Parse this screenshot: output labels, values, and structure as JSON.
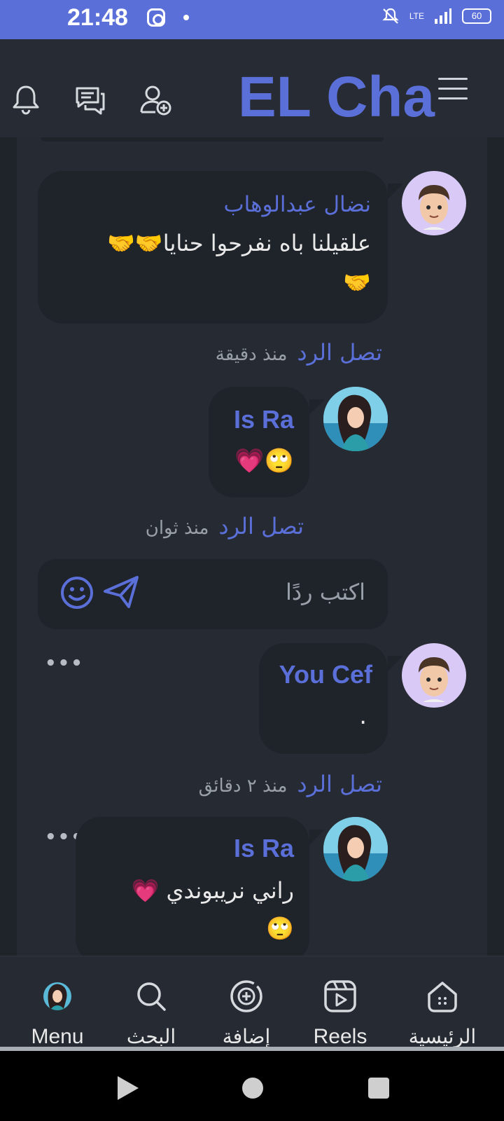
{
  "status_bar": {
    "time": "21:48",
    "network": "LTE",
    "battery": "60"
  },
  "header": {
    "brand": "EL Cha",
    "icons": [
      "bell-icon",
      "chat-icon",
      "add-friend-icon",
      "hamburger-menu-icon"
    ]
  },
  "feed": {
    "comments": [
      {
        "author": "نضال عبدالوهاب",
        "text": "علقيلنا باه نفرحوا حنايا🤝🤝",
        "text2": "🤝",
        "meta_reply": "تصل الرد",
        "meta_since": "منذ دقيقة"
      },
      {
        "author": "Is Ra",
        "text": "🙄💗",
        "meta_reply": "تصل الرد",
        "meta_since": "منذ ثوان"
      },
      {
        "author": "You Cef",
        "text": "."
      },
      {
        "author": "Is Ra",
        "text": "راني نريبوندي 💗",
        "text2": "🙄",
        "meta_reply": "تصل الرد",
        "meta_since": "منذ ٢ دقائق"
      }
    ],
    "composer": {
      "placeholder": "اكتب ردًا"
    },
    "more_label": "•••"
  },
  "bottom_nav": {
    "items": [
      {
        "label": "Menu",
        "icon": "profile-avatar-icon"
      },
      {
        "label": "البحث",
        "icon": "search-icon"
      },
      {
        "label": "إضافة",
        "icon": "add-circle-icon"
      },
      {
        "label": "Reels",
        "icon": "reels-icon"
      },
      {
        "label": "الرئيسية",
        "icon": "home-icon"
      }
    ]
  },
  "colors": {
    "accent": "#5b6fd9",
    "background": "#1f232a",
    "panel": "#262b33",
    "header": "#272c34",
    "muted": "#9aa0aa"
  }
}
